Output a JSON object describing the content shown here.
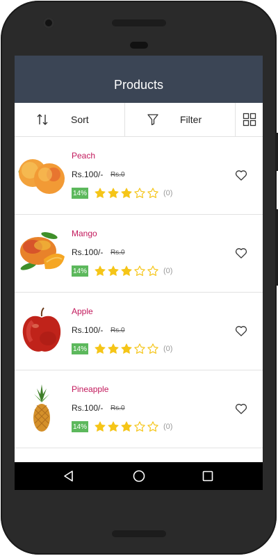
{
  "header": {
    "title": "Products"
  },
  "toolbar": {
    "sort_label": "Sort",
    "filter_label": "Filter",
    "sort_icon": "sort-arrows-icon",
    "filter_icon": "funnel-icon",
    "view_icon": "grid-view-icon"
  },
  "products": [
    {
      "name": "Peach",
      "price": "Rs.100/-",
      "old_price": "Rs.0",
      "discount": "14%",
      "rating": 3,
      "max_rating": 5,
      "review_count": "(0)"
    },
    {
      "name": "Mango",
      "price": "Rs.100/-",
      "old_price": "Rs.0",
      "discount": "14%",
      "rating": 3,
      "max_rating": 5,
      "review_count": "(0)"
    },
    {
      "name": "Apple",
      "price": "Rs.100/-",
      "old_price": "Rs.0",
      "discount": "14%",
      "rating": 3,
      "max_rating": 5,
      "review_count": "(0)"
    },
    {
      "name": "Pineapple",
      "price": "Rs.100/-",
      "old_price": "Rs.0",
      "discount": "14%",
      "rating": 3,
      "max_rating": 5,
      "review_count": "(0)"
    }
  ],
  "nav": {
    "back_icon": "back-triangle-icon",
    "home_icon": "home-circle-icon",
    "recent_icon": "recent-apps-square-icon"
  },
  "colors": {
    "appbar": "#3b4555",
    "product_name": "#c2185b",
    "discount_badge": "#5cb85c",
    "star_filled": "#f5c518",
    "star_empty": "#f5c518"
  }
}
